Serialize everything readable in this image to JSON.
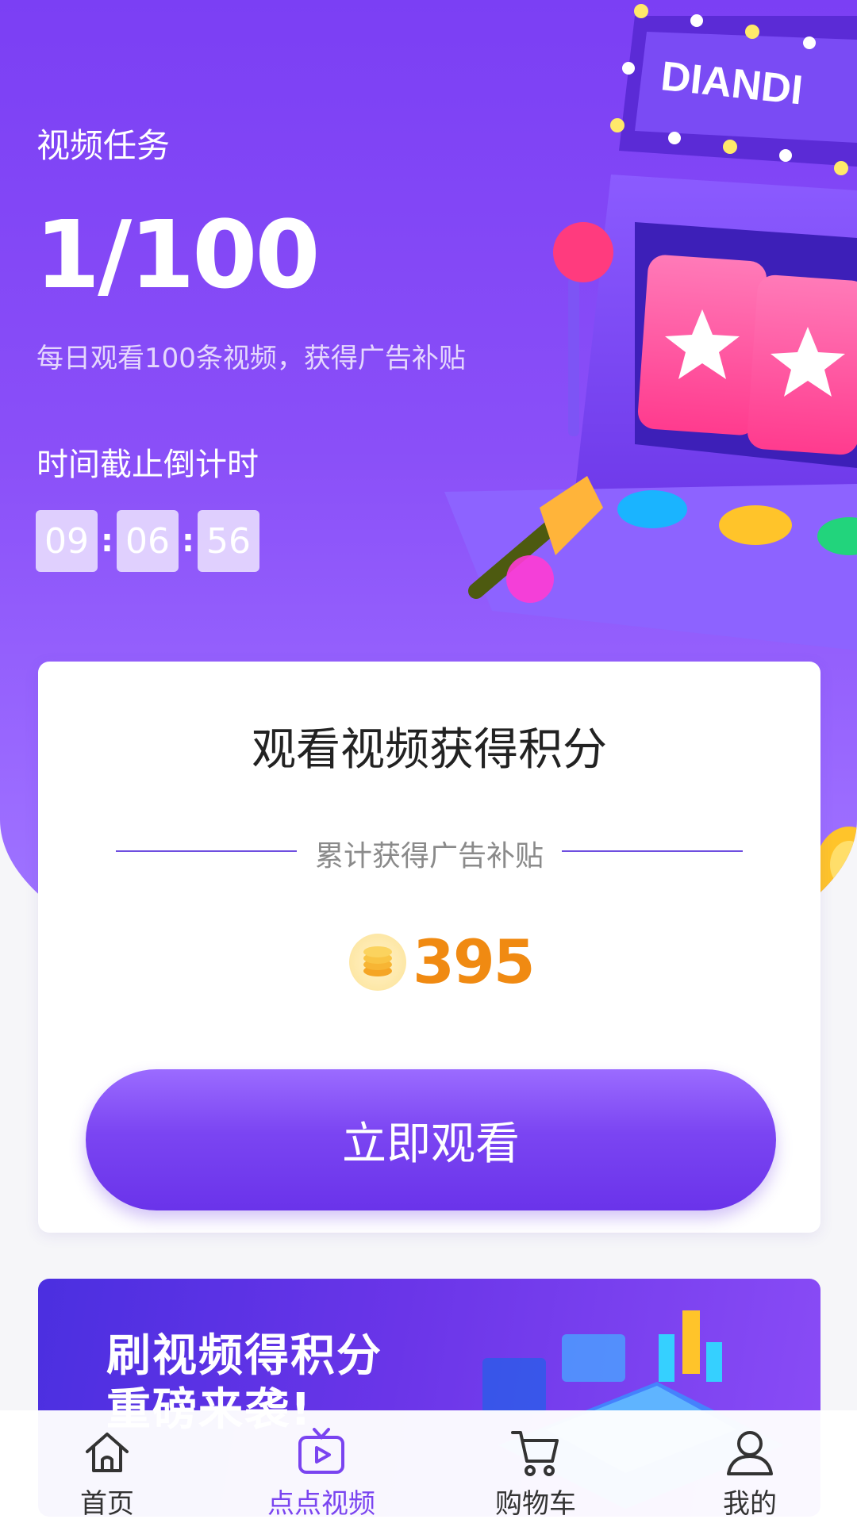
{
  "hero": {
    "task_title": "视频任务",
    "task_count": "1/100",
    "task_desc": "每日观看100条视频，获得广告补贴",
    "deadline_label": "时间截止倒计时",
    "countdown": {
      "hours": "09",
      "minutes": "06",
      "seconds": "56",
      "separator": ":"
    },
    "illustration_text": "DIANDI"
  },
  "card": {
    "title": "观看视频获得积分",
    "sub_label": "累计获得广告补贴",
    "points": "395",
    "watch_button": "立即观看"
  },
  "banner": {
    "line1": "刷视频得积分",
    "line2": "重磅来袭!"
  },
  "tabbar": {
    "items": [
      {
        "label": "首页",
        "icon": "home-icon",
        "active": false
      },
      {
        "label": "点点视频",
        "icon": "tv-play-icon",
        "active": true
      },
      {
        "label": "购物车",
        "icon": "cart-icon",
        "active": false
      },
      {
        "label": "我的",
        "icon": "user-icon",
        "active": false
      }
    ]
  },
  "colors": {
    "primary": "#7b3ff4",
    "accent_orange": "#f08a12",
    "active_tab": "#7a44f0"
  }
}
